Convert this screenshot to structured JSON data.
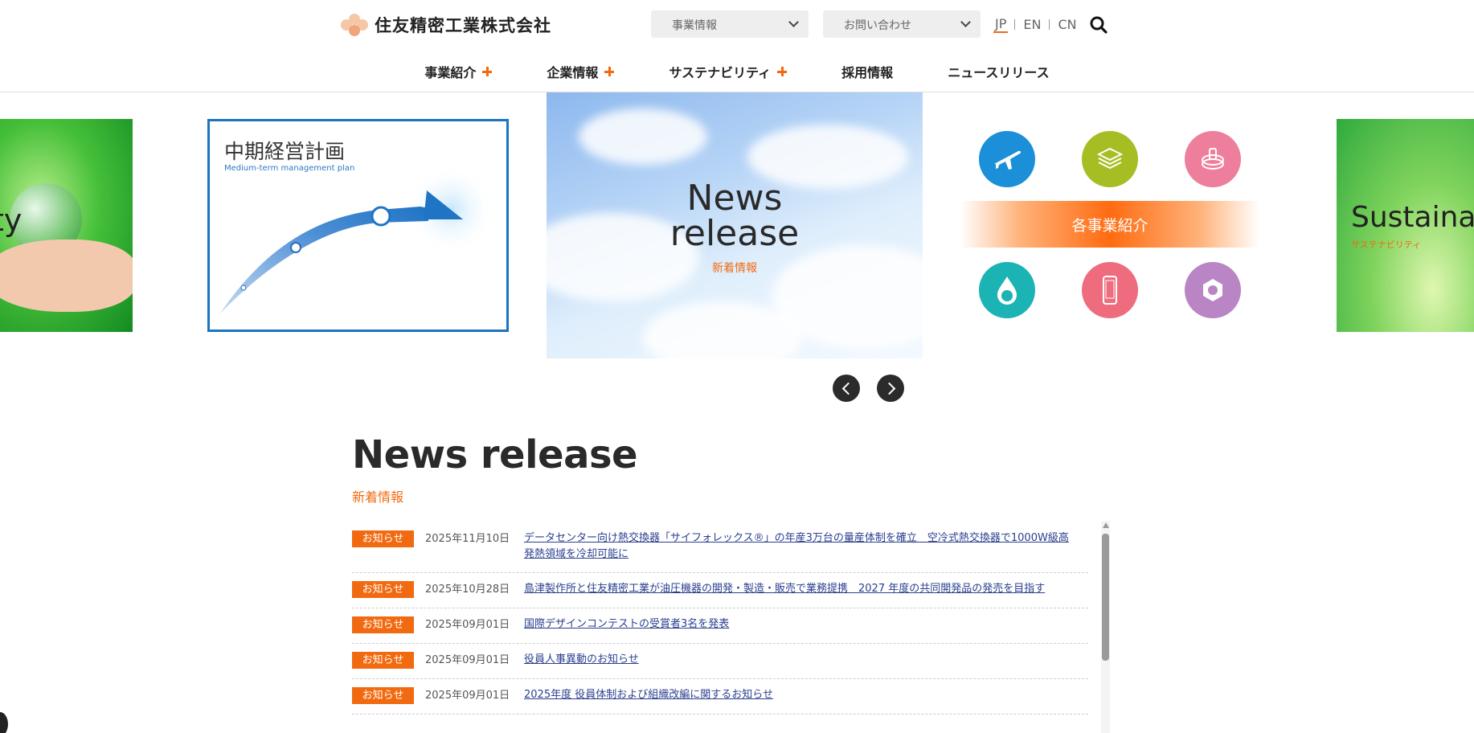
{
  "header": {
    "logo_text": "住友精密工業株式会社",
    "select_business": "事業情報",
    "select_contact": "お問い合わせ",
    "languages": [
      "JP",
      "EN",
      "CN"
    ],
    "active_language": "JP"
  },
  "nav": {
    "items": [
      {
        "label": "事業紹介",
        "has_submenu": true
      },
      {
        "label": "企業情報",
        "has_submenu": true
      },
      {
        "label": "サステナビリティ",
        "has_submenu": true
      },
      {
        "label": "採用情報",
        "has_submenu": false
      },
      {
        "label": "ニュースリリース",
        "has_submenu": false
      }
    ]
  },
  "carousel": {
    "left_partial_text": "ty",
    "plan_title": "中期経営計画",
    "plan_subtitle": "Medium-term management plan",
    "news_title_line1": "News",
    "news_title_line2": "release",
    "news_subtitle": "新着情報",
    "business_label": "各事業紹介",
    "right_partial_title": "Sustainab",
    "right_partial_subtitle": "サステナビリティ",
    "business_icons": [
      "airplane-icon",
      "heat-exchanger-icon",
      "gear-stack-icon",
      "water-globe-icon",
      "smartphone-chip-icon",
      "hex-nut-icon"
    ],
    "business_colors": [
      "#1b8fd8",
      "#a7bd24",
      "#ee7f9c",
      "#1bb3b3",
      "#ee6c7e",
      "#b985c4"
    ]
  },
  "news": {
    "heading": "News release",
    "subheading": "新着情報",
    "items": [
      {
        "badge": "お知らせ",
        "date": "2025年11月10日",
        "title": "データセンター向け熱交換器「サイフォレックス®」の年産3万台の量産体制を確立　空冷式熱交換器で1000W級高発熱領域を冷却可能に"
      },
      {
        "badge": "お知らせ",
        "date": "2025年10月28日",
        "title": "島津製作所と住友精密工業が油圧機器の開発・製造・販売で業務提携　2027 年度の共同開発品の発売を目指す"
      },
      {
        "badge": "お知らせ",
        "date": "2025年09月01日",
        "title": "国際デザインコンテストの受賞者3名を発表"
      },
      {
        "badge": "お知らせ",
        "date": "2025年09月01日",
        "title": "役員人事異動のお知らせ"
      },
      {
        "badge": "お知らせ",
        "date": "2025年09月01日",
        "title": "2025年度 役員体制および組織改編に関するお知らせ"
      }
    ]
  },
  "colors": {
    "accent": "#f26a10",
    "link": "#2a3f8f",
    "plan_border": "#1a74c0"
  }
}
